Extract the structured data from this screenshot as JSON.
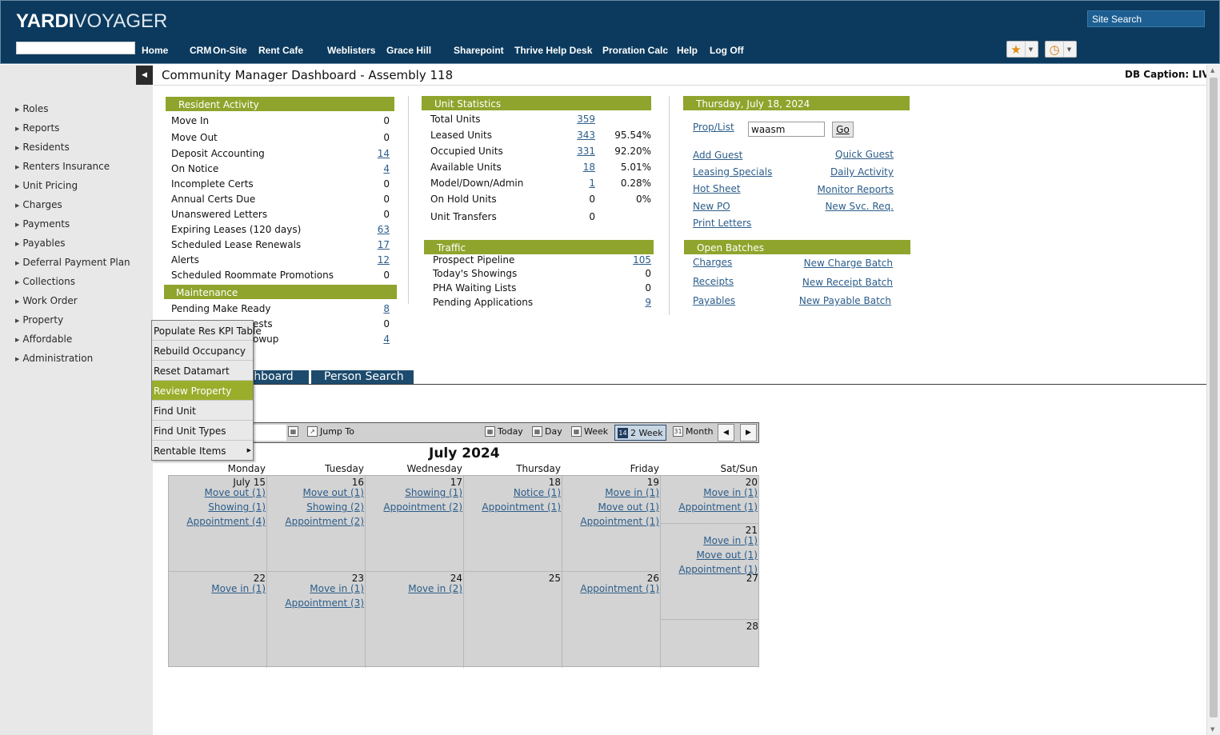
{
  "header": {
    "logo_bold": "YARDI",
    "logo_light": "VOYAGER",
    "site_search": "Site Search",
    "nav": [
      "Home",
      "CRM",
      "On-Site",
      "Rent Cafe",
      "Weblisters",
      "Grace Hill",
      "Sharepoint",
      "Thrive Help Desk",
      "Proration Calc",
      "Help",
      "Log Off"
    ],
    "favorites_icon": "star-icon",
    "history_icon": "clock-icon"
  },
  "sidebar": {
    "items": [
      "Roles",
      "Reports",
      "Residents",
      "Renters Insurance",
      "Unit Pricing",
      "Charges",
      "Payments",
      "Payables",
      "Deferral Payment Plan",
      "Collections",
      "Work Order",
      "Property",
      "Affordable",
      "Administration"
    ]
  },
  "page": {
    "title": "Community Manager Dashboard - Assembly 118",
    "db_caption": "DB Caption: LIVE"
  },
  "resident_activity": {
    "title": "Resident Activity",
    "rows": [
      {
        "label": "Move In",
        "value": "0",
        "link": false
      },
      {
        "label": "Move Out",
        "value": "0",
        "link": false
      },
      {
        "label": "Deposit Accounting",
        "value": "14",
        "link": true
      },
      {
        "label": "On Notice",
        "value": "4",
        "link": true
      },
      {
        "label": "Incomplete Certs",
        "value": "0",
        "link": false
      },
      {
        "label": "Annual Certs Due",
        "value": "0",
        "link": false
      },
      {
        "label": "Unanswered Letters",
        "value": "0",
        "link": false
      },
      {
        "label": "Expiring Leases (120 days)",
        "value": "63",
        "link": true
      },
      {
        "label": "Scheduled Lease Renewals",
        "value": "17",
        "link": true
      },
      {
        "label": "Alerts",
        "value": "12",
        "link": true
      },
      {
        "label": "Scheduled Roommate Promotions",
        "value": "0",
        "link": false
      }
    ]
  },
  "maintenance": {
    "title": "Maintenance",
    "rows": [
      {
        "label": "Pending Make Ready",
        "value": "8",
        "link": true
      },
      {
        "label": "ests",
        "value": "0",
        "link": false
      },
      {
        "label": "owup",
        "value": "4",
        "link": true
      }
    ]
  },
  "unit_statistics": {
    "title": "Unit Statistics",
    "rows": [
      {
        "label": "Total Units",
        "value": "359",
        "pct": ""
      },
      {
        "label": "Leased Units",
        "value": "343",
        "pct": "95.54%"
      },
      {
        "label": "Occupied Units",
        "value": "331",
        "pct": "92.20%"
      },
      {
        "label": "Available Units",
        "value": "18",
        "pct": "5.01%"
      },
      {
        "label": "Model/Down/Admin",
        "value": "1",
        "pct": "0.28%"
      },
      {
        "label": "On Hold Units",
        "value": "0",
        "pct": "0%"
      },
      {
        "label": "Unit Transfers",
        "value": "0",
        "pct": ""
      }
    ]
  },
  "traffic": {
    "title": "Traffic",
    "rows": [
      {
        "label": "Prospect Pipeline",
        "value": "105",
        "link": true
      },
      {
        "label": "Today's Showings",
        "value": "0",
        "link": false
      },
      {
        "label": "PHA Waiting Lists",
        "value": "0",
        "link": false
      },
      {
        "label": "Pending Applications",
        "value": "9",
        "link": true
      }
    ]
  },
  "date_panel": {
    "title": "Thursday, July 18, 2024",
    "prop_list": "Prop/List",
    "prop_value": "waasm",
    "go": "Go",
    "links_left": [
      "Add Guest",
      "Leasing Specials",
      "Hot Sheet",
      "New PO",
      "Print Letters"
    ],
    "links_right": [
      "Quick Guest",
      "Daily Activity",
      "Monitor Reports",
      "New Svc. Req."
    ]
  },
  "open_batches": {
    "title": "Open Batches",
    "rows": [
      {
        "left": "Charges",
        "right": "New Charge Batch"
      },
      {
        "left": "Receipts",
        "right": "New Receipt Batch"
      },
      {
        "left": "Payables",
        "right": "New Payable Batch"
      }
    ]
  },
  "context_menu": {
    "items": [
      "Populate Res KPI Table",
      "Rebuild Occupancy",
      "Reset Datamart",
      "Review Property",
      "Find Unit",
      "Find Unit Types",
      "Rentable Items"
    ],
    "highlighted": "Review Property"
  },
  "tabs": [
    "shboard",
    "Person Search"
  ],
  "calendar_toolbar": {
    "jump_to": "Jump To",
    "today": "Today",
    "day": "Day",
    "week": "Week",
    "two_week": "2 Week",
    "month": "Month"
  },
  "calendar": {
    "title": "July 2024",
    "day_names": [
      "Monday",
      "Tuesday",
      "Wednesday",
      "Thursday",
      "Friday",
      "Sat/Sun"
    ],
    "week1": [
      {
        "day": "July 15",
        "events": [
          "Move out (1)",
          "Showing (1)",
          "Appointment (4)"
        ]
      },
      {
        "day": "16",
        "events": [
          "Move out (1)",
          "Showing (2)",
          "Appointment (2)"
        ]
      },
      {
        "day": "17",
        "events": [
          "Showing (1)",
          "Appointment (2)"
        ]
      },
      {
        "day": "18",
        "events": [
          "Notice (1)",
          "Appointment (1)"
        ]
      },
      {
        "day": "19",
        "events": [
          "Move in (1)",
          "Move out (1)",
          "Appointment (1)"
        ]
      },
      {
        "day": "20",
        "events": [
          "Move in (1)",
          "Appointment (1)"
        ]
      },
      {
        "day": "21",
        "events": [
          "Move in (1)",
          "Move out (1)",
          "Appointment (1)"
        ]
      }
    ],
    "week2": [
      {
        "day": "22",
        "events": [
          "Move in (1)"
        ]
      },
      {
        "day": "23",
        "events": [
          "Move in (1)",
          "Appointment (3)"
        ]
      },
      {
        "day": "24",
        "events": [
          "Move in (2)"
        ]
      },
      {
        "day": "25",
        "events": []
      },
      {
        "day": "26",
        "events": [
          "Appointment (1)"
        ]
      },
      {
        "day": "27",
        "events": []
      },
      {
        "day": "28",
        "events": []
      }
    ]
  },
  "colors": {
    "header_bg": "#0b3a5e",
    "panel_head": "#8fa42c",
    "tab_bg": "#1d4b6e",
    "link": "#2c5d8a"
  }
}
